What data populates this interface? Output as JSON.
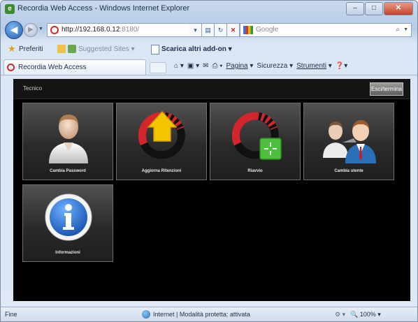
{
  "window": {
    "title": "Recordia Web Access - Windows Internet Explorer",
    "controls": {
      "minimize": "–",
      "maximize": "□",
      "close": "✕"
    }
  },
  "navbar": {
    "back": "◀",
    "forward": "▶",
    "url_host": "http://192.168.0.12",
    "url_port": ":8180/",
    "search_placeholder": "Google",
    "search_glyph": "⌕"
  },
  "favorites": {
    "label": "Preferiti",
    "suggested": "Suggested Sites ▾",
    "addons": "Scarica altri add-on ▾"
  },
  "tab": {
    "label": "Recordia Web Access"
  },
  "commands": {
    "page": "Pagina",
    "security": "Sicurezza",
    "tools": "Strumenti"
  },
  "app": {
    "header_title": "Tecnico",
    "logout_label": "Esci/termina",
    "tiles": [
      {
        "label": "Cambia Password",
        "icon": "user-icon"
      },
      {
        "label": "Aggiorna Ritenzioni",
        "icon": "update-icon"
      },
      {
        "label": "Riavvio",
        "icon": "restart-icon"
      },
      {
        "label": "Cambia utente",
        "icon": "switch-user-icon"
      },
      {
        "label": "Informazioni",
        "icon": "info-icon"
      }
    ]
  },
  "status": {
    "done": "Fine",
    "zone": "Internet | Modalità protetta: attivata",
    "zoom": "100%"
  },
  "colors": {
    "app_background": "#000000",
    "tile_top": "#515151",
    "tile_bottom": "#1e1e1e",
    "accent_red": "#d3262c",
    "accent_yellow": "#f5c400",
    "accent_green": "#4cbf3d",
    "info_blue": "#2a6fd0"
  }
}
